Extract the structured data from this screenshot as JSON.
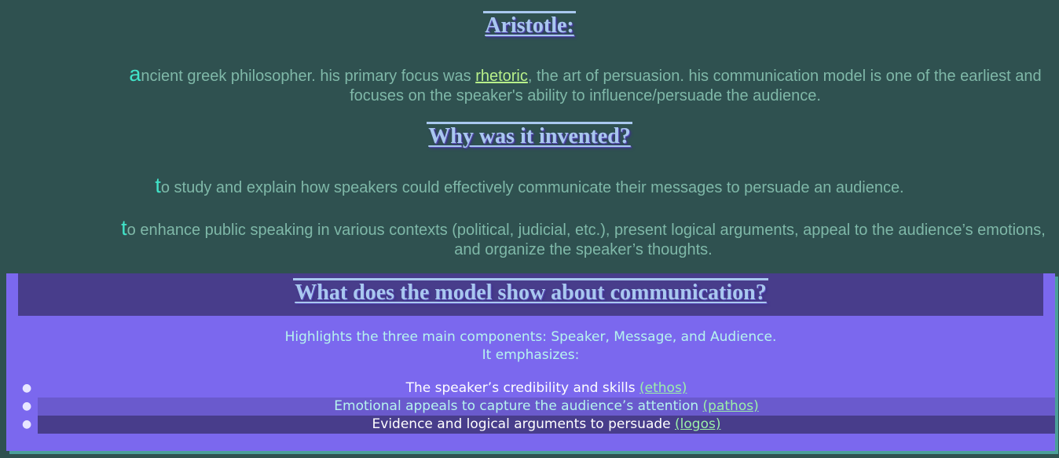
{
  "section1": {
    "heading": "Aristotle:",
    "cap": "a",
    "text_before": "ncient greek philosopher. his primary focus was ",
    "link": "rhetoric",
    "text_after": ", the art of persuasion. his communication model is one of the earliest and focuses on the speaker's ability to influence/persuade the audience."
  },
  "section2": {
    "heading": "Why was it invented?",
    "para1": {
      "cap": "t",
      "text": "o study and explain how speakers could effectively communicate their messages to persuade an audience."
    },
    "para2": {
      "cap": "t",
      "text": "o enhance public speaking in various contexts (political, judicial, etc.), present logical arguments, appeal to the audience’s emotions, and organize the speaker’s thoughts."
    }
  },
  "section3": {
    "heading": "What does the model show about communication?",
    "line1": "Highlights the three main components: Speaker, Message, and Audience.",
    "line2": "It emphasizes:",
    "items": [
      {
        "text": "The speaker’s credibility and skills ",
        "link": "(ethos)"
      },
      {
        "text": "Emotional appeals to capture the audience’s attention ",
        "link": "(pathos)"
      },
      {
        "text": "Evidence and logical arguments to persuade ",
        "link": "(logos)"
      }
    ]
  },
  "colors": {
    "background": "#2f5150",
    "panel": "#7b68ee",
    "panel_header": "#483d8b",
    "heading": "#a9c8ef",
    "link": "#b7f08a"
  }
}
